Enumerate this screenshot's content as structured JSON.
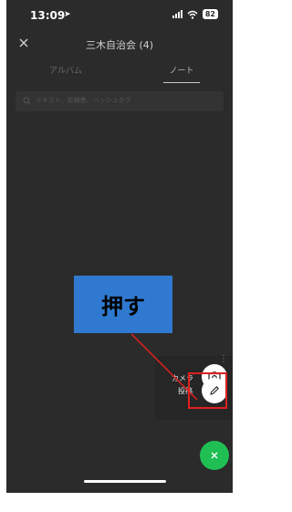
{
  "status_bar": {
    "time": "13:09",
    "battery": "82"
  },
  "header": {
    "title": "三木自治会 (4)"
  },
  "tabs": [
    {
      "label": "アルバム"
    },
    {
      "label": "ノート"
    }
  ],
  "search": {
    "placeholder": "テキスト、投稿者、ハッシュタグ"
  },
  "fab_menu": {
    "camera_label": "カメラ",
    "post_label": "投稿"
  },
  "annotation": {
    "callout_text": "押す",
    "color": "#e02020",
    "callout_bg": "#2f7ad0"
  },
  "colors": {
    "accent_green": "#1fbf54",
    "background": "#2b2b2b"
  }
}
